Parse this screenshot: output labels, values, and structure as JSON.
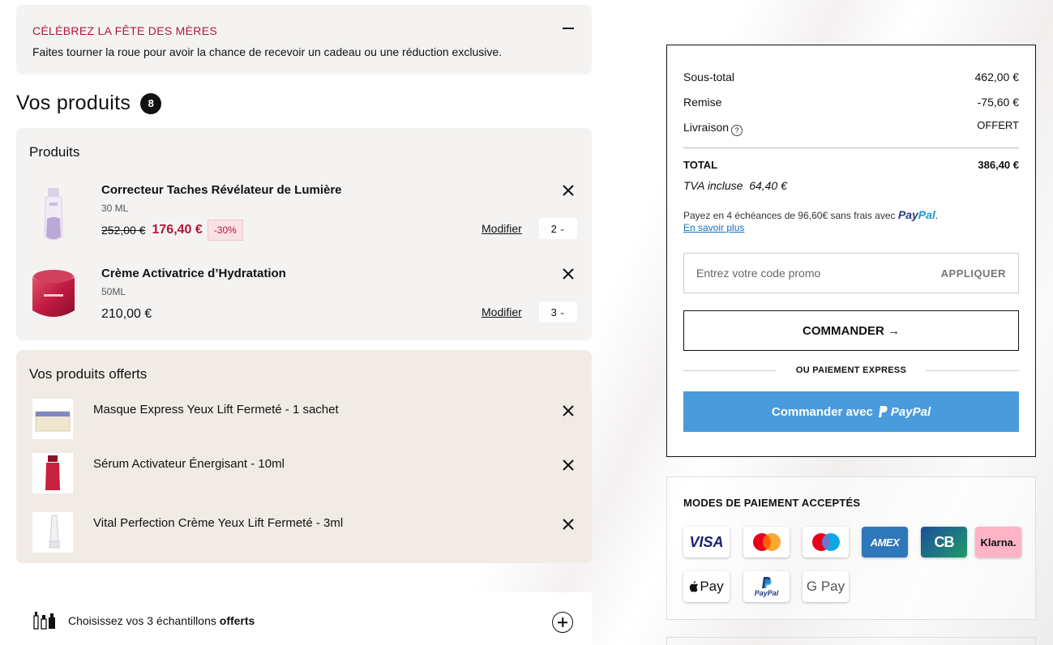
{
  "promo_banner": {
    "title": "CÉLÉBREZ LA FÊTE DES MÈRES",
    "text": "Faites tourner la roue pour avoir la chance de recevoir un cadeau ou une réduction exclusive."
  },
  "products_heading": {
    "title": "Vos produits",
    "count": "8"
  },
  "products_section": {
    "title": "Produits",
    "items": [
      {
        "name": "Correcteur Taches Révélateur de Lumière",
        "size": "30 ML",
        "old_price": "252,00 €",
        "price": "176,40 €",
        "discount": "-30%",
        "modify_label": "Modifier",
        "quantity": "2"
      },
      {
        "name": "Crème Activatrice d’Hydratation",
        "size": "50ML",
        "price": "210,00 €",
        "modify_label": "Modifier",
        "quantity": "3"
      }
    ]
  },
  "gifts_section": {
    "title": "Vos produits offerts",
    "items": [
      {
        "name": "Masque Express Yeux Lift Fermeté - 1 sachet"
      },
      {
        "name": "Sérum Activateur Énergisant - 10ml"
      },
      {
        "name": "Vital Perfection Crème Yeux Lift Fermeté - 3ml"
      }
    ]
  },
  "samples": {
    "text": "Choisissez vos 3 échantillons",
    "text_bold": "offerts"
  },
  "summary": {
    "subtotal_label": "Sous-total",
    "subtotal_value": "462,00 €",
    "discount_label": "Remise",
    "discount_value": "-75,60 €",
    "shipping_label": "Livraison",
    "shipping_value": "OFFERT",
    "total_label": "TOTAL",
    "total_value": "386,40 €",
    "tva_label": "TVA incluse",
    "tva_value": "64,40 €",
    "paypal_note": "Payez en 4 échéances de 96,60€ sans frais avec",
    "paypal_brand_a": "Pay",
    "paypal_brand_b": "Pal",
    "learn_more": "En savoir plus",
    "promo_placeholder": "Entrez votre code promo",
    "apply_label": "APPLIQUER",
    "checkout_label": "COMMANDER →",
    "express_label": "OU PAIEMENT EXPRESS",
    "paypal_button_label": "Commander avec",
    "paypal_button_brand": "PayPal"
  },
  "payments": {
    "title": "MODES DE PAIEMENT ACCEPTÉS",
    "methods": [
      "VISA",
      "Mastercard",
      "Maestro",
      "AMEX",
      "CB",
      "Klarna.",
      "Pay",
      "PayPal",
      "G Pay"
    ],
    "colors": {
      "visa": "#1a1f71",
      "amex": "#2e77bb",
      "cb_from": "#1b4f9c",
      "cb_to": "#1f9a6a",
      "klarna": "#ffb3c7"
    }
  },
  "colors": {
    "accent_red": "#b0163a",
    "paypal_button": "#4a9bdc",
    "gift_bg": "#f1ebe6",
    "card_bg": "#f4f3f2"
  }
}
